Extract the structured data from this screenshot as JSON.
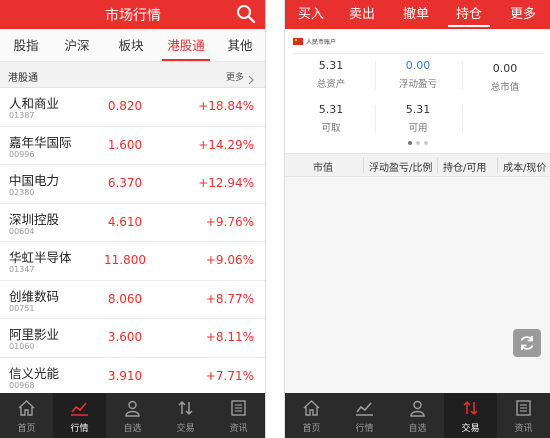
{
  "left": {
    "title": "市场行情",
    "tabs": [
      "股指",
      "沪深",
      "板块",
      "港股通",
      "其他"
    ],
    "active_tab": 3,
    "section": {
      "name": "港股通",
      "more": "更多"
    },
    "stocks": [
      {
        "name": "人和商业",
        "code": "01387",
        "price": "0.820",
        "change": "+18.84%"
      },
      {
        "name": "嘉年华国际",
        "code": "00996",
        "price": "1.600",
        "change": "+14.29%"
      },
      {
        "name": "中国电力",
        "code": "02380",
        "price": "6.370",
        "change": "+12.94%"
      },
      {
        "name": "深圳控股",
        "code": "00604",
        "price": "4.610",
        "change": "+9.76%"
      },
      {
        "name": "华虹半导体",
        "code": "01347",
        "price": "11.800",
        "change": "+9.06%"
      },
      {
        "name": "创维数码",
        "code": "00751",
        "price": "8.060",
        "change": "+8.77%"
      },
      {
        "name": "阿里影业",
        "code": "01060",
        "price": "3.600",
        "change": "+8.11%"
      },
      {
        "name": "信义光能",
        "code": "00968",
        "price": "3.910",
        "change": "+7.71%"
      }
    ],
    "bottom_nav": [
      {
        "label": "首页",
        "icon": "home-icon"
      },
      {
        "label": "行情",
        "icon": "chart-icon"
      },
      {
        "label": "自选",
        "icon": "user-icon"
      },
      {
        "label": "交易",
        "icon": "trade-icon"
      },
      {
        "label": "资讯",
        "icon": "news-icon"
      }
    ],
    "active_nav": 1
  },
  "right": {
    "tabs": [
      "买入",
      "卖出",
      "撤单",
      "持仓",
      "更多"
    ],
    "active_tab": 3,
    "account_label": "人民币账户",
    "stats": [
      {
        "value": "5.31",
        "label": "总资产"
      },
      {
        "value": "0.00",
        "label": "浮动盈亏"
      },
      {
        "value": "0.00",
        "label": "总市值"
      },
      {
        "value": "5.31",
        "label": "可取"
      },
      {
        "value": "5.31",
        "label": "可用"
      }
    ],
    "columns": [
      "市值",
      "浮动盈亏/比例",
      "持仓/可用",
      "成本/现价"
    ],
    "bottom_nav": [
      {
        "label": "首页",
        "icon": "home-icon"
      },
      {
        "label": "行情",
        "icon": "chart-icon"
      },
      {
        "label": "自选",
        "icon": "user-icon"
      },
      {
        "label": "交易",
        "icon": "trade-icon"
      },
      {
        "label": "资讯",
        "icon": "news-icon"
      }
    ],
    "active_nav": 3
  },
  "colors": {
    "brand_red": "#e8302f",
    "nav_bg": "#2b2b2b",
    "blue_value": "#3a7bd5"
  }
}
